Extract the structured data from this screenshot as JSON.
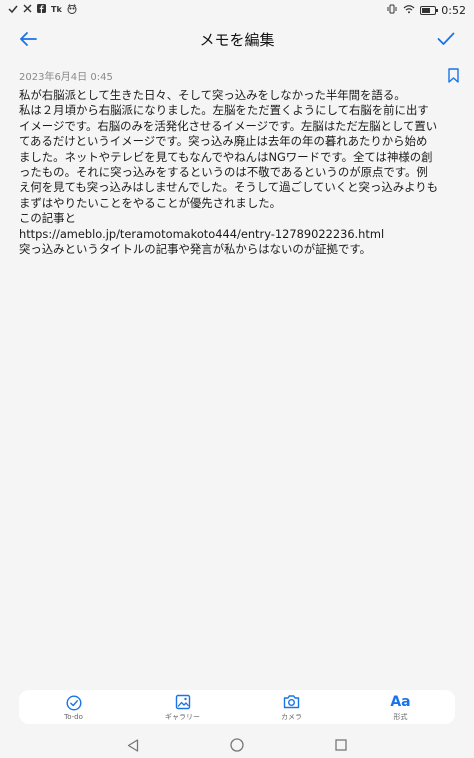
{
  "status_bar": {
    "time": "0:52",
    "left_icons": [
      "check-icon",
      "close-icon",
      "facebook-icon",
      "tk-icon",
      "owl-icon"
    ],
    "right_icons": [
      "vibrate-icon",
      "wifi-icon",
      "battery-icon"
    ],
    "tk_text": "Tk",
    "battery_level": 0.65
  },
  "header": {
    "title": "メモを編集",
    "back_icon": "arrow-back-icon",
    "confirm_icon": "check-icon"
  },
  "note": {
    "date": "2023年6月4日 0:45",
    "bookmark_icon": "bookmark-icon",
    "lines": [
      "私が右脳派として生きた日々、そして突っ込みをしなかった半年間を語る。",
      "私は２月頃から右脳派になりました。左脳をただ置くようにして右脳を前に出す",
      "イメージです。右脳のみを活発化させるイメージです。左脳はただ左脳として置い",
      "てあるだけというイメージです。突っ込み廃止は去年の年の暮れあたりから始め",
      "ました。ネットやテレビを見てもなんでやねんはNGワードです。全ては神様の創",
      "ったもの。それに突っ込みをするというのは不敬であるというのが原点です。例",
      "え何を見ても突っ込みはしませんでした。そうして過ごしていくと突っ込みよりも",
      "まずはやりたいことをやることが優先されました。",
      "この記事と",
      "https://ameblo.jp/teramotomakoto444/entry-12789022236.html",
      "突っ込みというタイトルの記事や発言が私からはないのが証拠です。"
    ]
  },
  "toolbar": {
    "items": [
      {
        "label": "To-do",
        "icon": "todo-check-icon"
      },
      {
        "label": "ギャラリー",
        "icon": "gallery-icon"
      },
      {
        "label": "カメラ",
        "icon": "camera-icon"
      },
      {
        "label": "形式",
        "icon": "format-text-icon",
        "glyph": "Aa"
      }
    ]
  },
  "nav_bar": {
    "icons": [
      "nav-back-icon",
      "nav-home-icon",
      "nav-recents-icon"
    ]
  },
  "colors": {
    "accent": "#1a73e8",
    "background": "#f5f5f5",
    "date_text": "#8a8a8a"
  }
}
